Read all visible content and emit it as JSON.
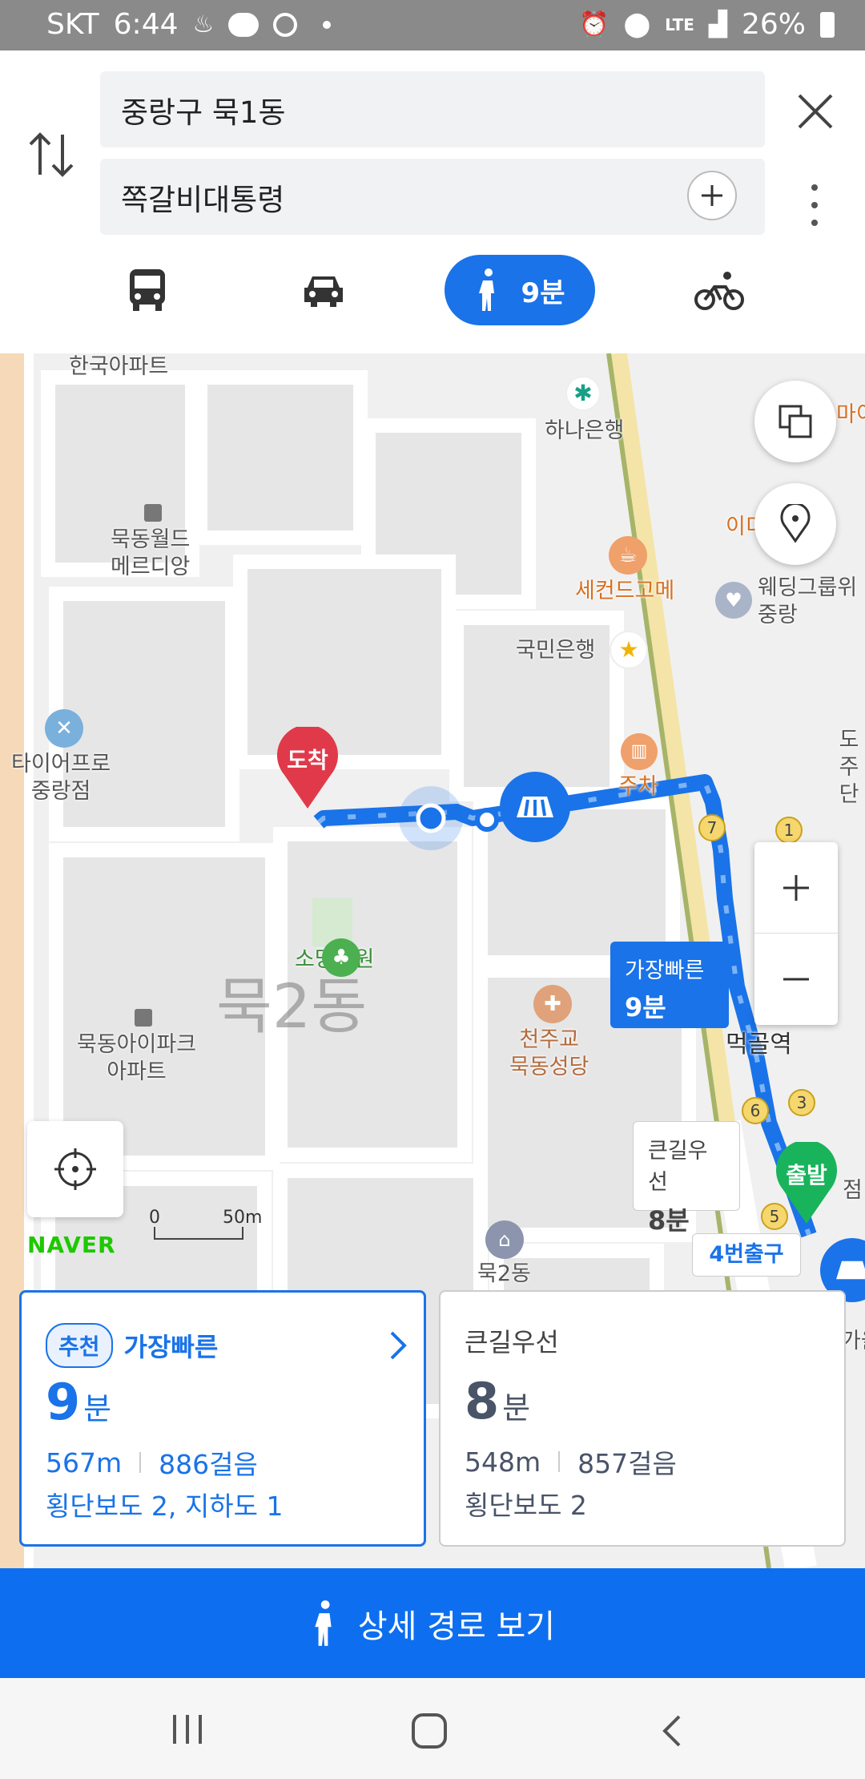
{
  "status_bar": {
    "carrier": "SKT",
    "time": "6:44",
    "network": "LTE",
    "battery": "26%"
  },
  "search": {
    "origin": "중랑구 묵1동",
    "destination": "쪽갈비대통령"
  },
  "modes": {
    "active_label": "9분"
  },
  "map": {
    "labels": {
      "korea_apt": "한국아파트",
      "hana_bank": "하나은행",
      "mukdong_world": "묵동월드\n메르디앙",
      "second_coffee": "세컨드고메",
      "wedding_group": "웨딩그룹위\n중랑",
      "kookmin_bank": "국민은행",
      "tire_pro": "타이어프로\n중랑점",
      "parking": "주차",
      "somang_park": "소망공원",
      "mukdong2_big": "묵2동",
      "church": "천주교\n묵동성당",
      "mukdong_ipark": "묵동아이파크\n아파트",
      "meokgol_station": "먹골역",
      "mukdong2_office": "묵2동",
      "ma_partial": "마이",
      "i_partial": "이디",
      "to_partial": "도\n주단",
      "ga_partial": "가을",
      "jeom_partial": "점",
      "scale": "50m",
      "scale_zero": "0",
      "brand": "NAVER",
      "exit4": "4번출구",
      "arrive": "도착",
      "depart": "출발"
    },
    "callouts": {
      "fastest_label": "가장빠른",
      "fastest_time": "9분",
      "mainroad_label": "큰길우선",
      "mainroad_time": "8분"
    },
    "badges": [
      "7",
      "1",
      "6",
      "3",
      "5"
    ]
  },
  "routes": [
    {
      "tag": "추천",
      "name": "가장빠른",
      "minutes": "9",
      "unit": "분",
      "distance": "567m",
      "steps": "886걸음",
      "details": "횡단보도 2, 지하도 1"
    },
    {
      "name": "큰길우선",
      "minutes": "8",
      "unit": "분",
      "distance": "548m",
      "steps": "857걸음",
      "details": "횡단보도 2"
    }
  ],
  "cta": {
    "label": "상세 경로 보기"
  },
  "colors": {
    "accent": "#1a73e8",
    "cta": "#0d6ff0",
    "route": "#1a73e8",
    "arrive_pin": "#e03a4a",
    "depart_pin": "#19b35c"
  }
}
